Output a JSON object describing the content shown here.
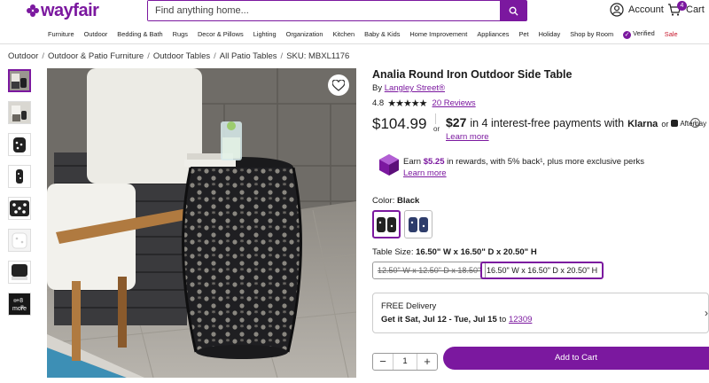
{
  "header": {
    "logo_text": "wayfair",
    "search": {
      "placeholder": "Find anything home..."
    },
    "account_label": "Account",
    "cart_label": "Cart",
    "cart_count": "4"
  },
  "nav": {
    "items": [
      "Furniture",
      "Outdoor",
      "Bedding & Bath",
      "Rugs",
      "Decor & Pillows",
      "Lighting",
      "Organization",
      "Kitchen",
      "Baby & Kids",
      "Home Improvement",
      "Appliances",
      "Pet",
      "Holiday",
      "Shop by Room"
    ],
    "verified_label": "Verified",
    "sale_label": "Sale",
    "sale_color": "#c7162b"
  },
  "breadcrumb": {
    "items": [
      "Outdoor",
      "Outdoor & Patio Furniture",
      "Outdoor Tables",
      "All Patio Tables"
    ],
    "sku": "SKU: MBXL1176"
  },
  "gallery": {
    "more_label": "+8 more"
  },
  "product": {
    "title": "Analia Round Iron Outdoor Side Table",
    "by_label": "By",
    "brand": "Langley Street®",
    "rating": "4.8",
    "reviews": "20 Reviews",
    "price": "$104.99",
    "or_label": "or",
    "installment_amount": "$27",
    "installment_text": "in 4 interest-free payments with",
    "klarna": "Klarna",
    "or2": "or",
    "afterpay": "Afterpay",
    "learn_more": "Learn more"
  },
  "rewards": {
    "earn_prefix": "Earn",
    "amount": "$5.25",
    "suffix": "in rewards, with 5% back¹, plus more exclusive perks",
    "learn_more": "Learn more"
  },
  "options": {
    "color_label": "Color:",
    "color_value": "Black",
    "size_label": "Table Size:",
    "size_value": "16.50\" W x 16.50\" D x 20.50\" H",
    "size_options": [
      "12.50\" W x 12.50\" D x 18.50\"",
      "16.50\" W x 16.50\" D x 20.50\" H"
    ]
  },
  "delivery": {
    "title": "FREE Delivery",
    "date_prefix": "Get it Sat, Jul 12 - Tue, Jul 15",
    "to_label": "to",
    "zip": "12309"
  },
  "purchase": {
    "quantity": "1",
    "add_to_cart": "Add to Cart"
  },
  "colors": {
    "brand": "#7b189f"
  }
}
